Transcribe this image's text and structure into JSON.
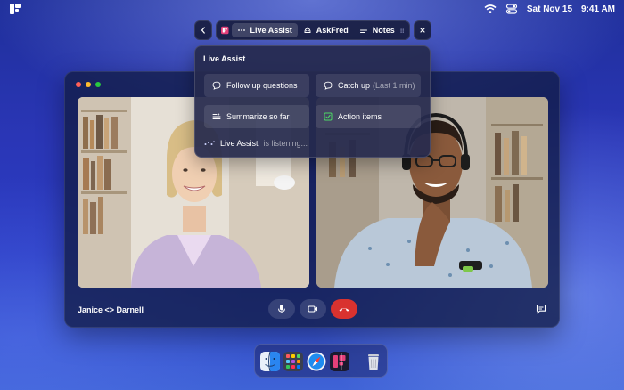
{
  "menubar": {
    "date": "Sat Nov 15",
    "time": "9:41 AM"
  },
  "toolbar": {
    "tabs": [
      {
        "label": "Live Assist",
        "icon": "dots-icon",
        "active": true
      },
      {
        "label": "AskFred",
        "icon": "fred-icon",
        "active": false
      },
      {
        "label": "Notes",
        "icon": "notes-icon",
        "active": false
      }
    ]
  },
  "assist": {
    "title": "Live Assist",
    "actions": [
      {
        "label": "Follow up questions",
        "suffix": "",
        "icon": "chat-bubble-icon"
      },
      {
        "label": "Catch up",
        "suffix": "(Last 1 min)",
        "icon": "chat-bubble-icon"
      },
      {
        "label": "Summarize so far",
        "suffix": "",
        "icon": "summary-icon"
      },
      {
        "label": "Action items",
        "suffix": "",
        "icon": "checkbox-icon"
      }
    ],
    "status_name": "Live Assist",
    "status_text": "is listening..."
  },
  "meeting": {
    "title": "Janice <> Darnell",
    "participants": [
      "Janice",
      "Darnell"
    ],
    "controls": [
      "microphone-icon",
      "camera-icon",
      "end-call-icon"
    ]
  },
  "dock": {
    "apps": [
      "finder-icon",
      "launchpad-icon",
      "safari-icon",
      "fireflies-icon",
      "trash-icon"
    ]
  },
  "colors": {
    "end_call": "#d9322f",
    "brand": "#e5407a",
    "check": "#4cd964"
  }
}
